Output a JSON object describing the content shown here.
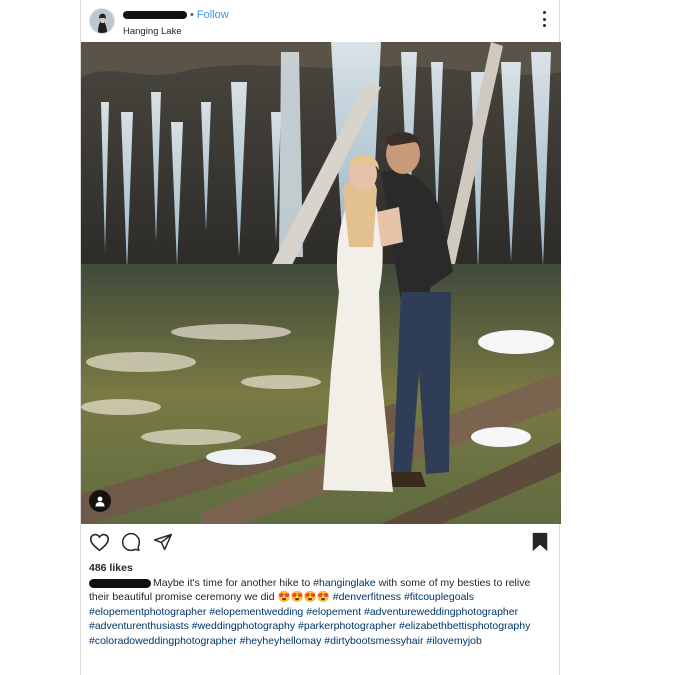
{
  "header": {
    "follow_label": "Follow",
    "separator": "•",
    "location": "Hanging Lake"
  },
  "post": {
    "likes": "486 likes",
    "caption_parts": {
      "p1": "Maybe it's time for another hike to ",
      "t1": "#hanginglake",
      "p2": " with some of my besties to relive their beautiful promise ceremony we did ",
      "emoji": "😍😍😍😍",
      "p3": " ",
      "t2": "#denverfitness",
      "p4": " ",
      "t3": "#fitcouplegoals",
      "t4": "#elopementphotographer",
      "t5": "#elopementwedding",
      "t6": "#elopement",
      "t7": "#adventureweddingphotographer",
      "t8": "#adventurenthusiasts",
      "t9": "#weddingphotography",
      "t10": "#parkerphotographer",
      "t11": "#elizabethbettisphotography",
      "t12": "#coloradoweddingphotographer",
      "t13": "#heyheyhellomay",
      "t14": "#dirtybootsmessyhair",
      "t15": "#ilovemyjob"
    }
  },
  "icons": {
    "more": "more-options-icon",
    "like": "heart-icon",
    "comment": "comment-icon",
    "share": "send-icon",
    "save": "bookmark-icon",
    "tag": "user-tag-icon"
  },
  "colors": {
    "link_blue": "#3897f0",
    "hashtag": "#003569",
    "text": "#262626"
  }
}
